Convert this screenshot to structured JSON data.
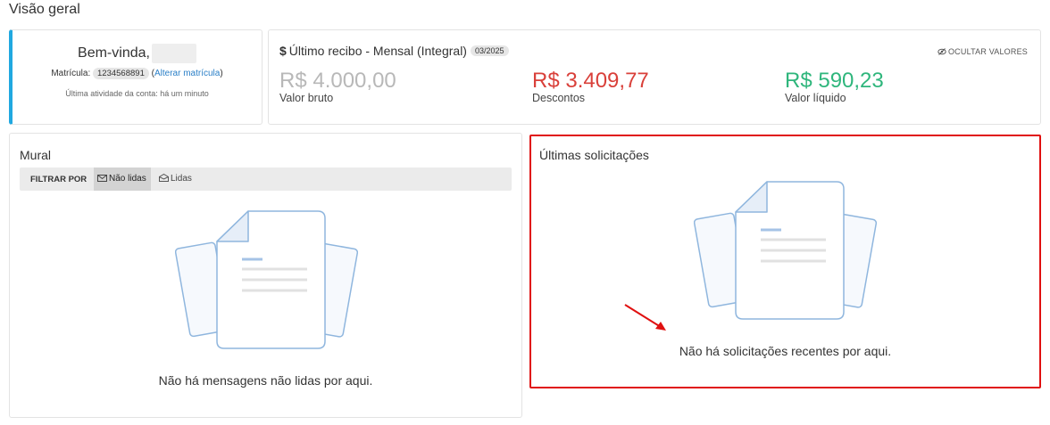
{
  "page": {
    "title": "Visão geral"
  },
  "welcome": {
    "greeting": "Bem-vinda,",
    "registration_label": "Matrícula:",
    "registration_number": "1234568891",
    "change_registration": "Alterar matrícula",
    "last_activity": "Última atividade da conta: há um minuto"
  },
  "receipt": {
    "icon": "dollar-icon",
    "title": "Último recibo - Mensal (Integral)",
    "period": "03/2025",
    "hide_values": "OCULTAR VALORES",
    "gross_value": "R$ 4.000,00",
    "gross_label": "Valor bruto",
    "discounts_value": "R$ 3.409,77",
    "discounts_label": "Descontos",
    "net_value": "R$ 590,23",
    "net_label": "Valor líquido",
    "colors": {
      "gross": "#b8b8b8",
      "discounts": "#d9403a",
      "net": "#2fb67c"
    }
  },
  "mural": {
    "title": "Mural",
    "filter_label": "FILTRAR POR",
    "tab_unread": "Não lidas",
    "tab_read": "Lidas",
    "empty_message": "Não há mensagens não lidas por aqui."
  },
  "requests": {
    "title": "Últimas solicitações",
    "empty_message": "Não há solicitações recentes por aqui.",
    "highlight_color": "#e01010"
  }
}
